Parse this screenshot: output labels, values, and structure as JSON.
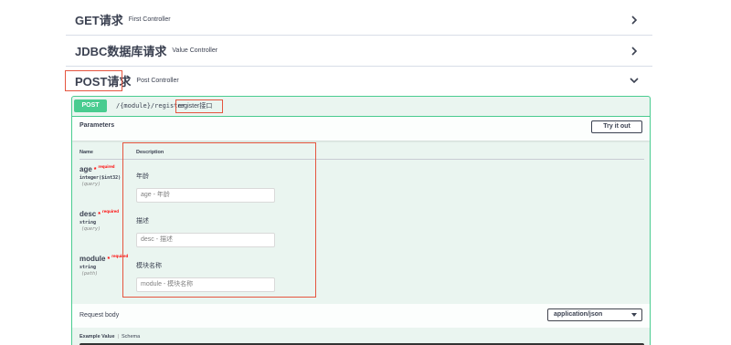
{
  "tags": [
    {
      "name": "GET请求",
      "desc": "First Controller"
    },
    {
      "name": "JDBC数据库请求",
      "desc": "Value Controller"
    },
    {
      "name": "POST请求",
      "desc": "Post Controller"
    }
  ],
  "icons": {
    "collapsed": "chevron-right-icon",
    "expanded": "chevron-down-icon"
  },
  "operation": {
    "method": "POST",
    "path": "/{module}/register",
    "summary": "register接口",
    "color": "#49cc90"
  },
  "parameters": {
    "title": "Parameters",
    "try_label": "Try it out",
    "col_name": "Name",
    "col_desc": "Description",
    "items": [
      {
        "name": "age",
        "star": "*",
        "required": "required",
        "type": "integer($int32)",
        "in": "(query)",
        "label": "年龄",
        "placeholder": "age - 年龄"
      },
      {
        "name": "desc",
        "star": "*",
        "required": "required",
        "type": "string",
        "in": "(query)",
        "label": "描述",
        "placeholder": "desc - 描述"
      },
      {
        "name": "module",
        "star": "*",
        "required": "required",
        "type": "string",
        "in": "(path)",
        "label": "模块名称",
        "placeholder": "module - 模块名称"
      }
    ]
  },
  "request_body": {
    "title": "Request body",
    "content_type": "application/json",
    "example_value_tab": "Example Value",
    "schema_tab": "Schema"
  },
  "highlight_color": "#e5553f"
}
